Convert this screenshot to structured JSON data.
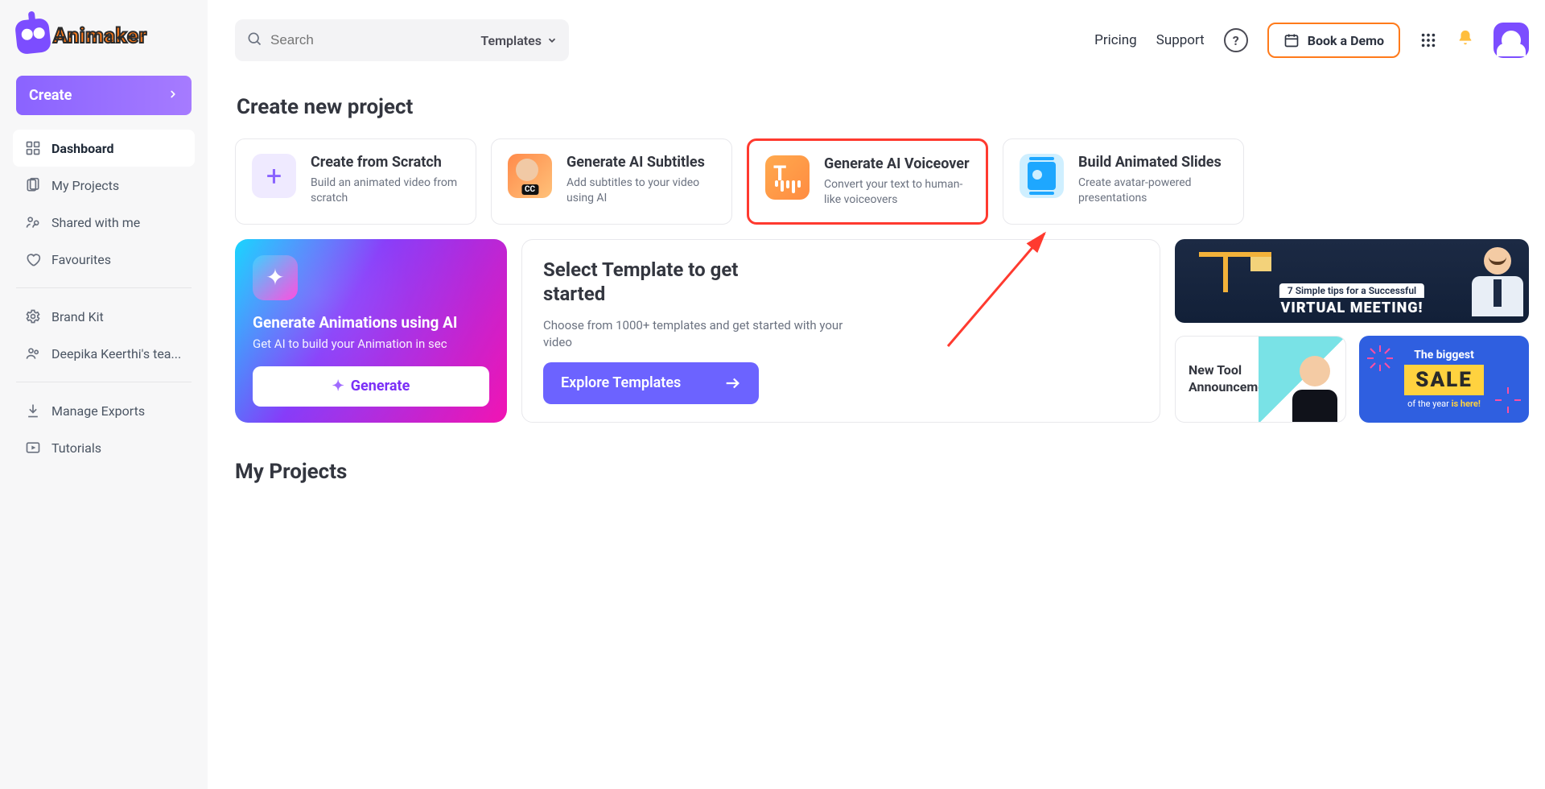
{
  "logo": {
    "text": "Animaker"
  },
  "sidebar": {
    "create": "Create",
    "items1": [
      {
        "label": "Dashboard",
        "icon": "dashboard-icon"
      },
      {
        "label": "My Projects",
        "icon": "files-icon"
      },
      {
        "label": "Shared with me",
        "icon": "share-icon"
      },
      {
        "label": "Favourites",
        "icon": "heart-icon"
      }
    ],
    "items2": [
      {
        "label": "Brand Kit",
        "icon": "gear-icon"
      },
      {
        "label": "Deepika Keerthi's tea...",
        "icon": "team-icon"
      }
    ],
    "items3": [
      {
        "label": "Manage Exports",
        "icon": "export-icon"
      },
      {
        "label": "Tutorials",
        "icon": "play-icon"
      }
    ]
  },
  "header": {
    "search_placeholder": "Search",
    "templates_label": "Templates",
    "pricing": "Pricing",
    "support": "Support",
    "demo": "Book a Demo"
  },
  "sections": {
    "create_title": "Create new project",
    "cards": [
      {
        "title": "Create from Scratch",
        "desc": "Build an animated video from scratch"
      },
      {
        "title": "Generate AI Subtitles",
        "desc": "Add subtitles to your video using AI"
      },
      {
        "title": "Generate AI Voiceover",
        "desc": "Convert your text to human-like voiceovers"
      },
      {
        "title": "Build Animated Slides",
        "desc": "Create avatar-powered presentations"
      }
    ],
    "ai": {
      "title": "Generate Animations using AI",
      "subtitle": "Get AI to build your Animation in sec",
      "button": "Generate"
    },
    "template": {
      "title": "Select Template to get started",
      "desc": "Choose from 1000+ templates and get started with your video",
      "button": "Explore Templates"
    },
    "promo": {
      "tip_small": "7 Simple tips for a Successful",
      "tip_big": "VIRTUAL MEETING!",
      "announce": "New Tool Announcement",
      "sale_top": "The biggest",
      "sale_mid": "SALE",
      "sale_bot_a": "of the year",
      "sale_bot_b": "is here!"
    },
    "myprojects": "My Projects"
  }
}
